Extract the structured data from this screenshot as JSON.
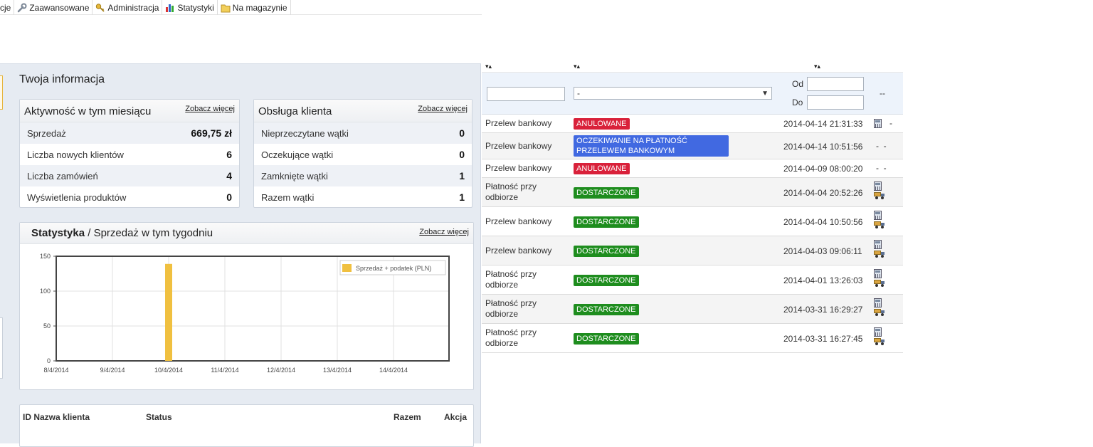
{
  "top_menu": {
    "tabs": [
      {
        "label": "cje",
        "icon": "none"
      },
      {
        "label": "Zaawansowane",
        "icon": "wrench-icon"
      },
      {
        "label": "Administracja",
        "icon": "key-icon"
      },
      {
        "label": "Statystyki",
        "icon": "bar-chart-icon"
      },
      {
        "label": "Na magazynie",
        "icon": "folder-icon"
      }
    ]
  },
  "dashboard": {
    "heading": "Twoja informacja",
    "activity": {
      "title": "Aktywność w tym miesiącu",
      "see_more": "Zobacz więcej",
      "rows": [
        {
          "label": "Sprzedaż",
          "value": "669,75 zł"
        },
        {
          "label": "Liczba nowych klientów",
          "value": "6"
        },
        {
          "label": "Liczba zamówień",
          "value": "4"
        },
        {
          "label": "Wyświetlenia produktów",
          "value": "0"
        }
      ]
    },
    "support": {
      "title": "Obsługa klienta",
      "see_more": "Zobacz więcej",
      "rows": [
        {
          "label": "Nieprzeczytane wątki",
          "value": "0"
        },
        {
          "label": "Oczekujące wątki",
          "value": "0"
        },
        {
          "label": "Zamknięte wątki",
          "value": "1"
        },
        {
          "label": "Razem wątki",
          "value": "1"
        }
      ]
    },
    "stats": {
      "title_bold": "Statystyka",
      "title_sep": " / ",
      "title_rest": "Sprzedaż w tym tygodniu",
      "see_more": "Zobacz więcej"
    },
    "orders_table": {
      "col_id_name": "ID Nazwa klienta",
      "col_status": "Status",
      "col_total": "Razem",
      "col_action": "Akcja"
    }
  },
  "chart_data": {
    "type": "bar",
    "categories": [
      "8/4/2014",
      "9/4/2014",
      "10/4/2014",
      "11/4/2014",
      "12/4/2014",
      "13/4/2014",
      "14/4/2014"
    ],
    "series": [
      {
        "name": "Sprzedaż + podatek (PLN)",
        "values": [
          0,
          0,
          139,
          0,
          0,
          0,
          0
        ]
      }
    ],
    "yticks": [
      "0",
      "50",
      "100",
      "150"
    ],
    "ylim": [
      0,
      150
    ],
    "grid": true,
    "legend_position": "top-right",
    "color": "#f0c040"
  },
  "orders": {
    "sort_arrows": "▾▴",
    "filter": {
      "text_placeholder": "",
      "select_value": "-",
      "from_label": "Od",
      "to_label": "Do",
      "action_dash": "--"
    },
    "rows": [
      {
        "payment": "Przelew bankowy",
        "status": "ANULOWANE",
        "status_color": "red",
        "date": "2014-04-14 21:31:33",
        "icons": [
          "calc"
        ],
        "dashes": "-"
      },
      {
        "payment": "Przelew bankowy",
        "status": "OCZEKIWANIE NA PŁATNOŚĆ PRZELEWEM BANKOWYM",
        "status_color": "blue",
        "date": "2014-04-14 10:51:56",
        "icons": [],
        "dashes": "-  -"
      },
      {
        "payment": "Przelew bankowy",
        "status": "ANULOWANE",
        "status_color": "red",
        "date": "2014-04-09 08:00:20",
        "icons": [],
        "dashes": "-  -"
      },
      {
        "payment": "Płatność przy odbiorze",
        "status": "DOSTARCZONE",
        "status_color": "green",
        "date": "2014-04-04 20:52:26",
        "icons": [
          "calc",
          "truck"
        ],
        "dashes": ""
      },
      {
        "payment": "Przelew bankowy",
        "status": "DOSTARCZONE",
        "status_color": "green",
        "date": "2014-04-04 10:50:56",
        "icons": [
          "calc",
          "truck"
        ],
        "dashes": ""
      },
      {
        "payment": "Przelew bankowy",
        "status": "DOSTARCZONE",
        "status_color": "green",
        "date": "2014-04-03 09:06:11",
        "icons": [
          "calc",
          "truck"
        ],
        "dashes": ""
      },
      {
        "payment": "Płatność przy odbiorze",
        "status": "DOSTARCZONE",
        "status_color": "green",
        "date": "2014-04-01 13:26:03",
        "icons": [
          "calc",
          "truck"
        ],
        "dashes": ""
      },
      {
        "payment": "Płatność przy odbiorze",
        "status": "DOSTARCZONE",
        "status_color": "green",
        "date": "2014-03-31 16:29:27",
        "icons": [
          "calc",
          "truck"
        ],
        "dashes": ""
      },
      {
        "payment": "Płatność przy odbiorze",
        "status": "DOSTARCZONE",
        "status_color": "green",
        "date": "2014-03-31 16:27:45",
        "icons": [
          "calc",
          "truck"
        ],
        "dashes": ""
      }
    ]
  }
}
